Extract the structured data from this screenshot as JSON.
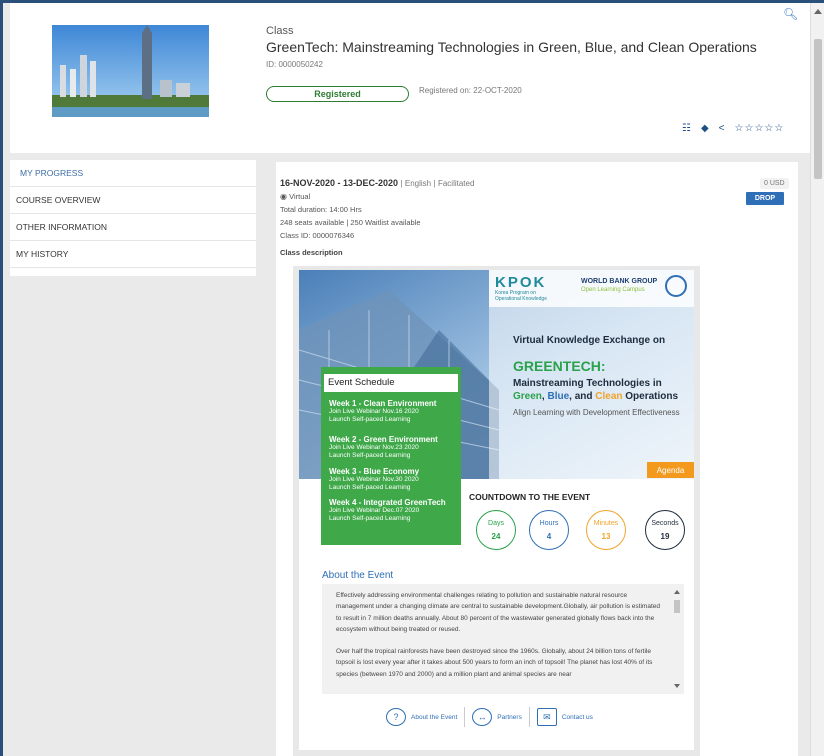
{
  "header": {
    "kicker": "Class",
    "title": "GreenTech: Mainstreaming Technologies in Green, Blue, and Clean Operations",
    "class_id": "ID: 0000050242",
    "status": "Registered",
    "registered_on": "Registered on: 22-OCT-2020",
    "stars": "☆☆☆☆☆"
  },
  "sidebar": {
    "items": [
      {
        "label": "MY PROGRESS"
      },
      {
        "label": "COURSE OVERVIEW"
      },
      {
        "label": "OTHER INFORMATION"
      },
      {
        "label": "MY HISTORY"
      }
    ]
  },
  "offering": {
    "dates": "16-NOV-2020 - 13-DEC-2020",
    "language": "English",
    "mode": "Facilitated",
    "location": "Virtual",
    "duration": "Total duration: 14:00 Hrs",
    "seats": "248 seats available",
    "waitlist": "250 Waitlist available",
    "class_id": "Class ID: 0000076346",
    "price": "0 USD",
    "drop_label": "DROP",
    "description_label": "Class description"
  },
  "flyer": {
    "kpok_logo": "KPOK",
    "kpok_sub1": "Korea Program on",
    "kpok_sub2": "Operational Knowledge",
    "wbg": "WORLD BANK GROUP",
    "olc": "Open Learning Campus",
    "exchange": "Virtual Knowledge Exchange on",
    "greentech": "GREENTECH:",
    "sub_line1": "Mainstreaming Technologies in",
    "sub_green": "Green",
    "sub_blue": "Blue",
    "sub_and": ", and",
    "sub_clean": "Clean",
    "sub_ops": "Operations",
    "align": "Align Learning with Development Effectiveness",
    "agenda": "Agenda",
    "schedule_title": "Event Schedule",
    "weeks": [
      {
        "title": "Week 1 - Clean Environment",
        "line1": "Join Live Webinar Nov.16 2020",
        "line2": "Launch Self-paced Learning"
      },
      {
        "title": "Week 2 - Green Environment",
        "line1": "Join Live Webinar Nov.23 2020",
        "line2": "Launch Self-paced Learning"
      },
      {
        "title": "Week 3 - Blue Economy",
        "line1": "Join Live Webinar Nov.30 2020",
        "line2": "Launch Self-paced Learning"
      },
      {
        "title": "Week 4 - Integrated GreenTech",
        "line1": "Join Live Webinar Dec.07 2020",
        "line2": "Launch Self-paced Learning"
      }
    ],
    "countdown_title": "COUNTDOWN TO THE EVENT",
    "countdown": {
      "days_label": "Days",
      "days": "24",
      "hours_label": "Hours",
      "hours": "4",
      "minutes_label": "Minutes",
      "minutes": "13",
      "seconds_label": "Seconds",
      "seconds": "19"
    },
    "about_title": "About the Event",
    "about_p1": "Effectively addressing environmental challenges relating to pollution and sustainable natural resource management under a changing climate are central to sustainable development.Globally, air pollution is estimated to result in 7 million deaths annually. About 80 percent of the wastewater generated globally flows back into the ecosystem without being treated or reused.",
    "about_p2": "Over half the tropical rainforests have been destroyed since the 1960s. Globally, about 24 billion tons of fertile topsoil is lost every year after it takes about 500 years to form an inch of topsoil! The planet has lost 40% of its species (between 1970 and 2000) and a million plant and animal species are near",
    "footer": {
      "about": "About the Event",
      "partners": "Partners",
      "contact": "Contact us"
    }
  },
  "colors": {
    "accent": "#2e6fb8",
    "green": "#3fa94a",
    "orange": "#f39a1e",
    "registered": "#2e7d32"
  }
}
